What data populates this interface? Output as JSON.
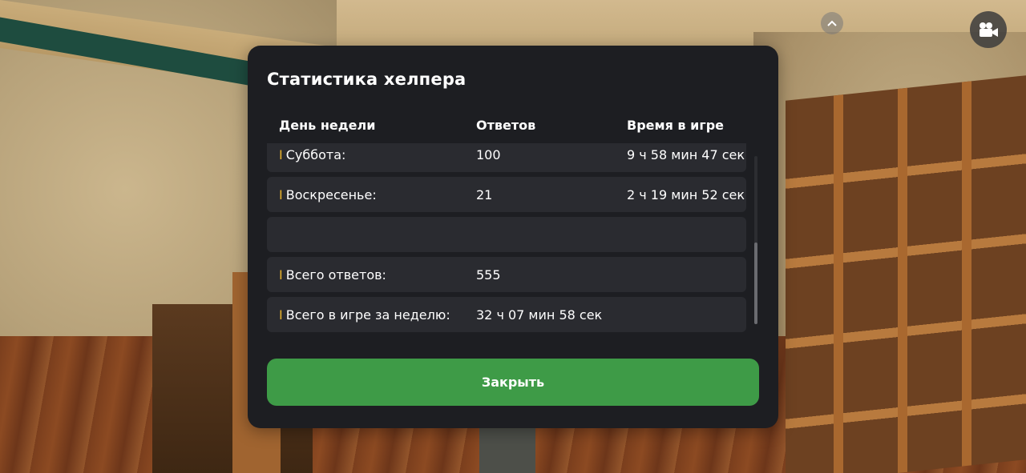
{
  "dialog": {
    "title": "Статистика хелпера",
    "columns": {
      "day": "День недели",
      "answers": "Ответов",
      "time": "Время в игре"
    },
    "rows": [
      {
        "day": "Суббота:",
        "answers": "100",
        "time": "9 ч 58 мин 47 сек"
      },
      {
        "day": "Воскресенье:",
        "answers": "21",
        "time": "2 ч 19 мин 52 сек"
      },
      {
        "day": "",
        "answers": "",
        "time": ""
      },
      {
        "day": "Всего ответов:",
        "answers": "555",
        "time": ""
      },
      {
        "day": "Всего в игре за неделю:",
        "answers": "32 ч 07 мин 58 сек",
        "time": ""
      }
    ],
    "row_marker": "I",
    "close_label": "Закрыть"
  },
  "colors": {
    "accent_marker": "#e8b22b",
    "button_green": "#3e9b47",
    "panel": "#1d1e22",
    "row": "#2a2b30"
  },
  "icons": {
    "top_toggle": "chevron-up-icon",
    "record": "video-camera-icon"
  }
}
